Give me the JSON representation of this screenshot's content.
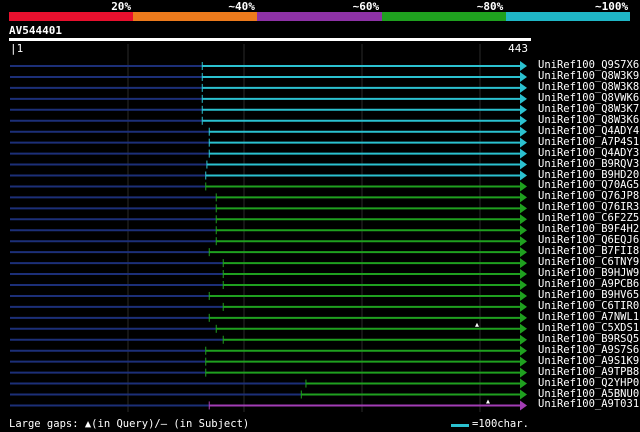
{
  "legend": {
    "colors": [
      "#e8102e",
      "#ec7a1c",
      "#8e32a6",
      "#1fa01f",
      "#1fb6c6"
    ],
    "percent_labels": [
      "20%",
      "~40%",
      "~60%",
      "~80%",
      "~100%"
    ]
  },
  "query": {
    "id": "AV544401",
    "start": "1",
    "end": "443",
    "length": 443
  },
  "hits": [
    {
      "name": "UniRef100_Q9S7X6",
      "start": 166,
      "end": 443,
      "color": "cyan"
    },
    {
      "name": "UniRef100_Q8W3K9",
      "start": 166,
      "end": 443,
      "color": "cyan"
    },
    {
      "name": "UniRef100_Q8W3K8",
      "start": 166,
      "end": 443,
      "color": "cyan"
    },
    {
      "name": "UniRef100_Q8VWK6",
      "start": 166,
      "end": 443,
      "color": "cyan"
    },
    {
      "name": "UniRef100_Q8W3K7",
      "start": 166,
      "end": 443,
      "color": "cyan"
    },
    {
      "name": "UniRef100_Q8W3K6",
      "start": 166,
      "end": 443,
      "color": "cyan"
    },
    {
      "name": "UniRef100_Q4ADY4",
      "start": 172,
      "end": 443,
      "color": "cyan"
    },
    {
      "name": "UniRef100_A7P4S1",
      "start": 172,
      "end": 443,
      "color": "cyan"
    },
    {
      "name": "UniRef100_Q4ADY3",
      "start": 172,
      "end": 443,
      "color": "cyan"
    },
    {
      "name": "UniRef100_B9RQV3",
      "start": 170,
      "end": 443,
      "color": "cyan"
    },
    {
      "name": "UniRef100_B9HD20",
      "start": 169,
      "end": 443,
      "color": "cyan"
    },
    {
      "name": "UniRef100_Q70AG5",
      "start": 169,
      "end": 443,
      "color": "green"
    },
    {
      "name": "UniRef100_Q76JP8",
      "start": 178,
      "end": 443,
      "color": "green"
    },
    {
      "name": "UniRef100_Q76IR3",
      "start": 178,
      "end": 443,
      "color": "green"
    },
    {
      "name": "UniRef100_C6F2Z5",
      "start": 178,
      "end": 443,
      "color": "green"
    },
    {
      "name": "UniRef100_B9F4H2",
      "start": 178,
      "end": 443,
      "color": "green"
    },
    {
      "name": "UniRef100_Q6EQJ6",
      "start": 178,
      "end": 443,
      "color": "green"
    },
    {
      "name": "UniRef100_B7FII8",
      "start": 172,
      "end": 443,
      "color": "green"
    },
    {
      "name": "UniRef100_C6TNY9",
      "start": 184,
      "end": 443,
      "color": "green"
    },
    {
      "name": "UniRef100_B9HJW9",
      "start": 184,
      "end": 443,
      "color": "green"
    },
    {
      "name": "UniRef100_A9PCB6",
      "start": 184,
      "end": 443,
      "color": "green"
    },
    {
      "name": "UniRef100_B9HV65",
      "start": 172,
      "end": 443,
      "color": "green"
    },
    {
      "name": "UniRef100_C6TIR0",
      "start": 184,
      "end": 443,
      "color": "green"
    },
    {
      "name": "UniRef100_A7NWL1",
      "start": 172,
      "end": 443,
      "color": "green"
    },
    {
      "name": "UniRef100_C5XDS1",
      "start": 178,
      "end": 443,
      "color": "green"
    },
    {
      "name": "UniRef100_B9RSQ5",
      "start": 184,
      "end": 443,
      "color": "green"
    },
    {
      "name": "UniRef100_A9S7S6",
      "start": 169,
      "end": 443,
      "color": "green"
    },
    {
      "name": "UniRef100_A9S1K9",
      "start": 169,
      "end": 443,
      "color": "green"
    },
    {
      "name": "UniRef100_A9TPB8",
      "start": 169,
      "end": 443,
      "color": "green"
    },
    {
      "name": "UniRef100_Q2YHP0",
      "start": 255,
      "end": 443,
      "color": "green"
    },
    {
      "name": "UniRef100_A5BNU0",
      "start": 251,
      "end": 443,
      "color": "green"
    },
    {
      "name": "UniRef100_A9T031",
      "start": 172,
      "end": 443,
      "color": "purple"
    }
  ],
  "footer": {
    "large_gaps_text": "Large gaps: ▲(in Query)/– (in Subject)",
    "scale_text": "=100char."
  }
}
